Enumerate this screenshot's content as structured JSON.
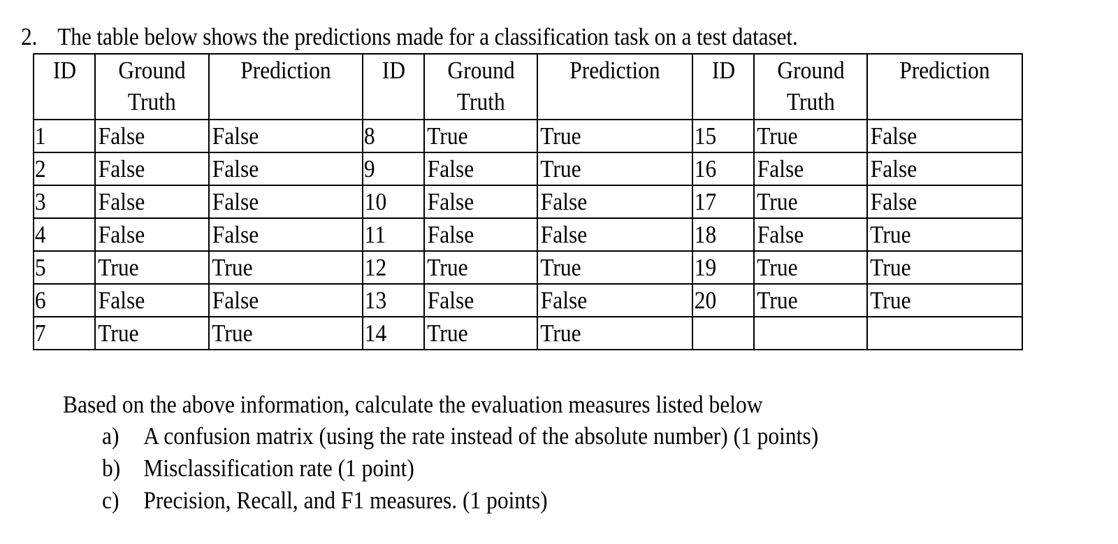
{
  "question": {
    "number": "2.",
    "text": "The table below shows the predictions made for a classification task on a test dataset."
  },
  "table": {
    "headers": [
      {
        "id": "ID",
        "ground_truth": "Ground Truth",
        "prediction": "Prediction"
      },
      {
        "id": "ID",
        "ground_truth": "Ground Truth",
        "prediction": "Prediction"
      },
      {
        "id": "ID",
        "ground_truth": "Ground Truth",
        "prediction": "Prediction"
      }
    ],
    "header_ground_line1": "Ground",
    "header_ground_line2": "Truth",
    "rows": [
      [
        {
          "id": "1",
          "gt": "False",
          "pred": "False"
        },
        {
          "id": "8",
          "gt": "True",
          "pred": "True"
        },
        {
          "id": "15",
          "gt": "True",
          "pred": "False"
        }
      ],
      [
        {
          "id": "2",
          "gt": "False",
          "pred": "False"
        },
        {
          "id": "9",
          "gt": "False",
          "pred": "True"
        },
        {
          "id": "16",
          "gt": "False",
          "pred": "False"
        }
      ],
      [
        {
          "id": "3",
          "gt": "False",
          "pred": "False"
        },
        {
          "id": "10",
          "gt": "False",
          "pred": "False"
        },
        {
          "id": "17",
          "gt": "True",
          "pred": "False"
        }
      ],
      [
        {
          "id": "4",
          "gt": "False",
          "pred": "False"
        },
        {
          "id": "11",
          "gt": "False",
          "pred": "False"
        },
        {
          "id": "18",
          "gt": "False",
          "pred": "True"
        }
      ],
      [
        {
          "id": "5",
          "gt": "True",
          "pred": "True"
        },
        {
          "id": "12",
          "gt": "True",
          "pred": "True"
        },
        {
          "id": "19",
          "gt": "True",
          "pred": "True"
        }
      ],
      [
        {
          "id": "6",
          "gt": "False",
          "pred": "False"
        },
        {
          "id": "13",
          "gt": "False",
          "pred": "False"
        },
        {
          "id": "20",
          "gt": "True",
          "pred": "True"
        }
      ],
      [
        {
          "id": "7",
          "gt": "True",
          "pred": "True"
        },
        {
          "id": "14",
          "gt": "True",
          "pred": "True"
        },
        {
          "id": "",
          "gt": "",
          "pred": ""
        }
      ]
    ]
  },
  "instructions": "Based on the above information, calculate the evaluation measures listed below",
  "items": [
    {
      "mark": "a)",
      "text": "A confusion matrix (using the rate instead of the absolute number) (1 points)"
    },
    {
      "mark": "b)",
      "text": "Misclassification rate (1 point)"
    },
    {
      "mark": "c)",
      "text": "Precision, Recall, and F1 measures. (1 points)"
    }
  ]
}
